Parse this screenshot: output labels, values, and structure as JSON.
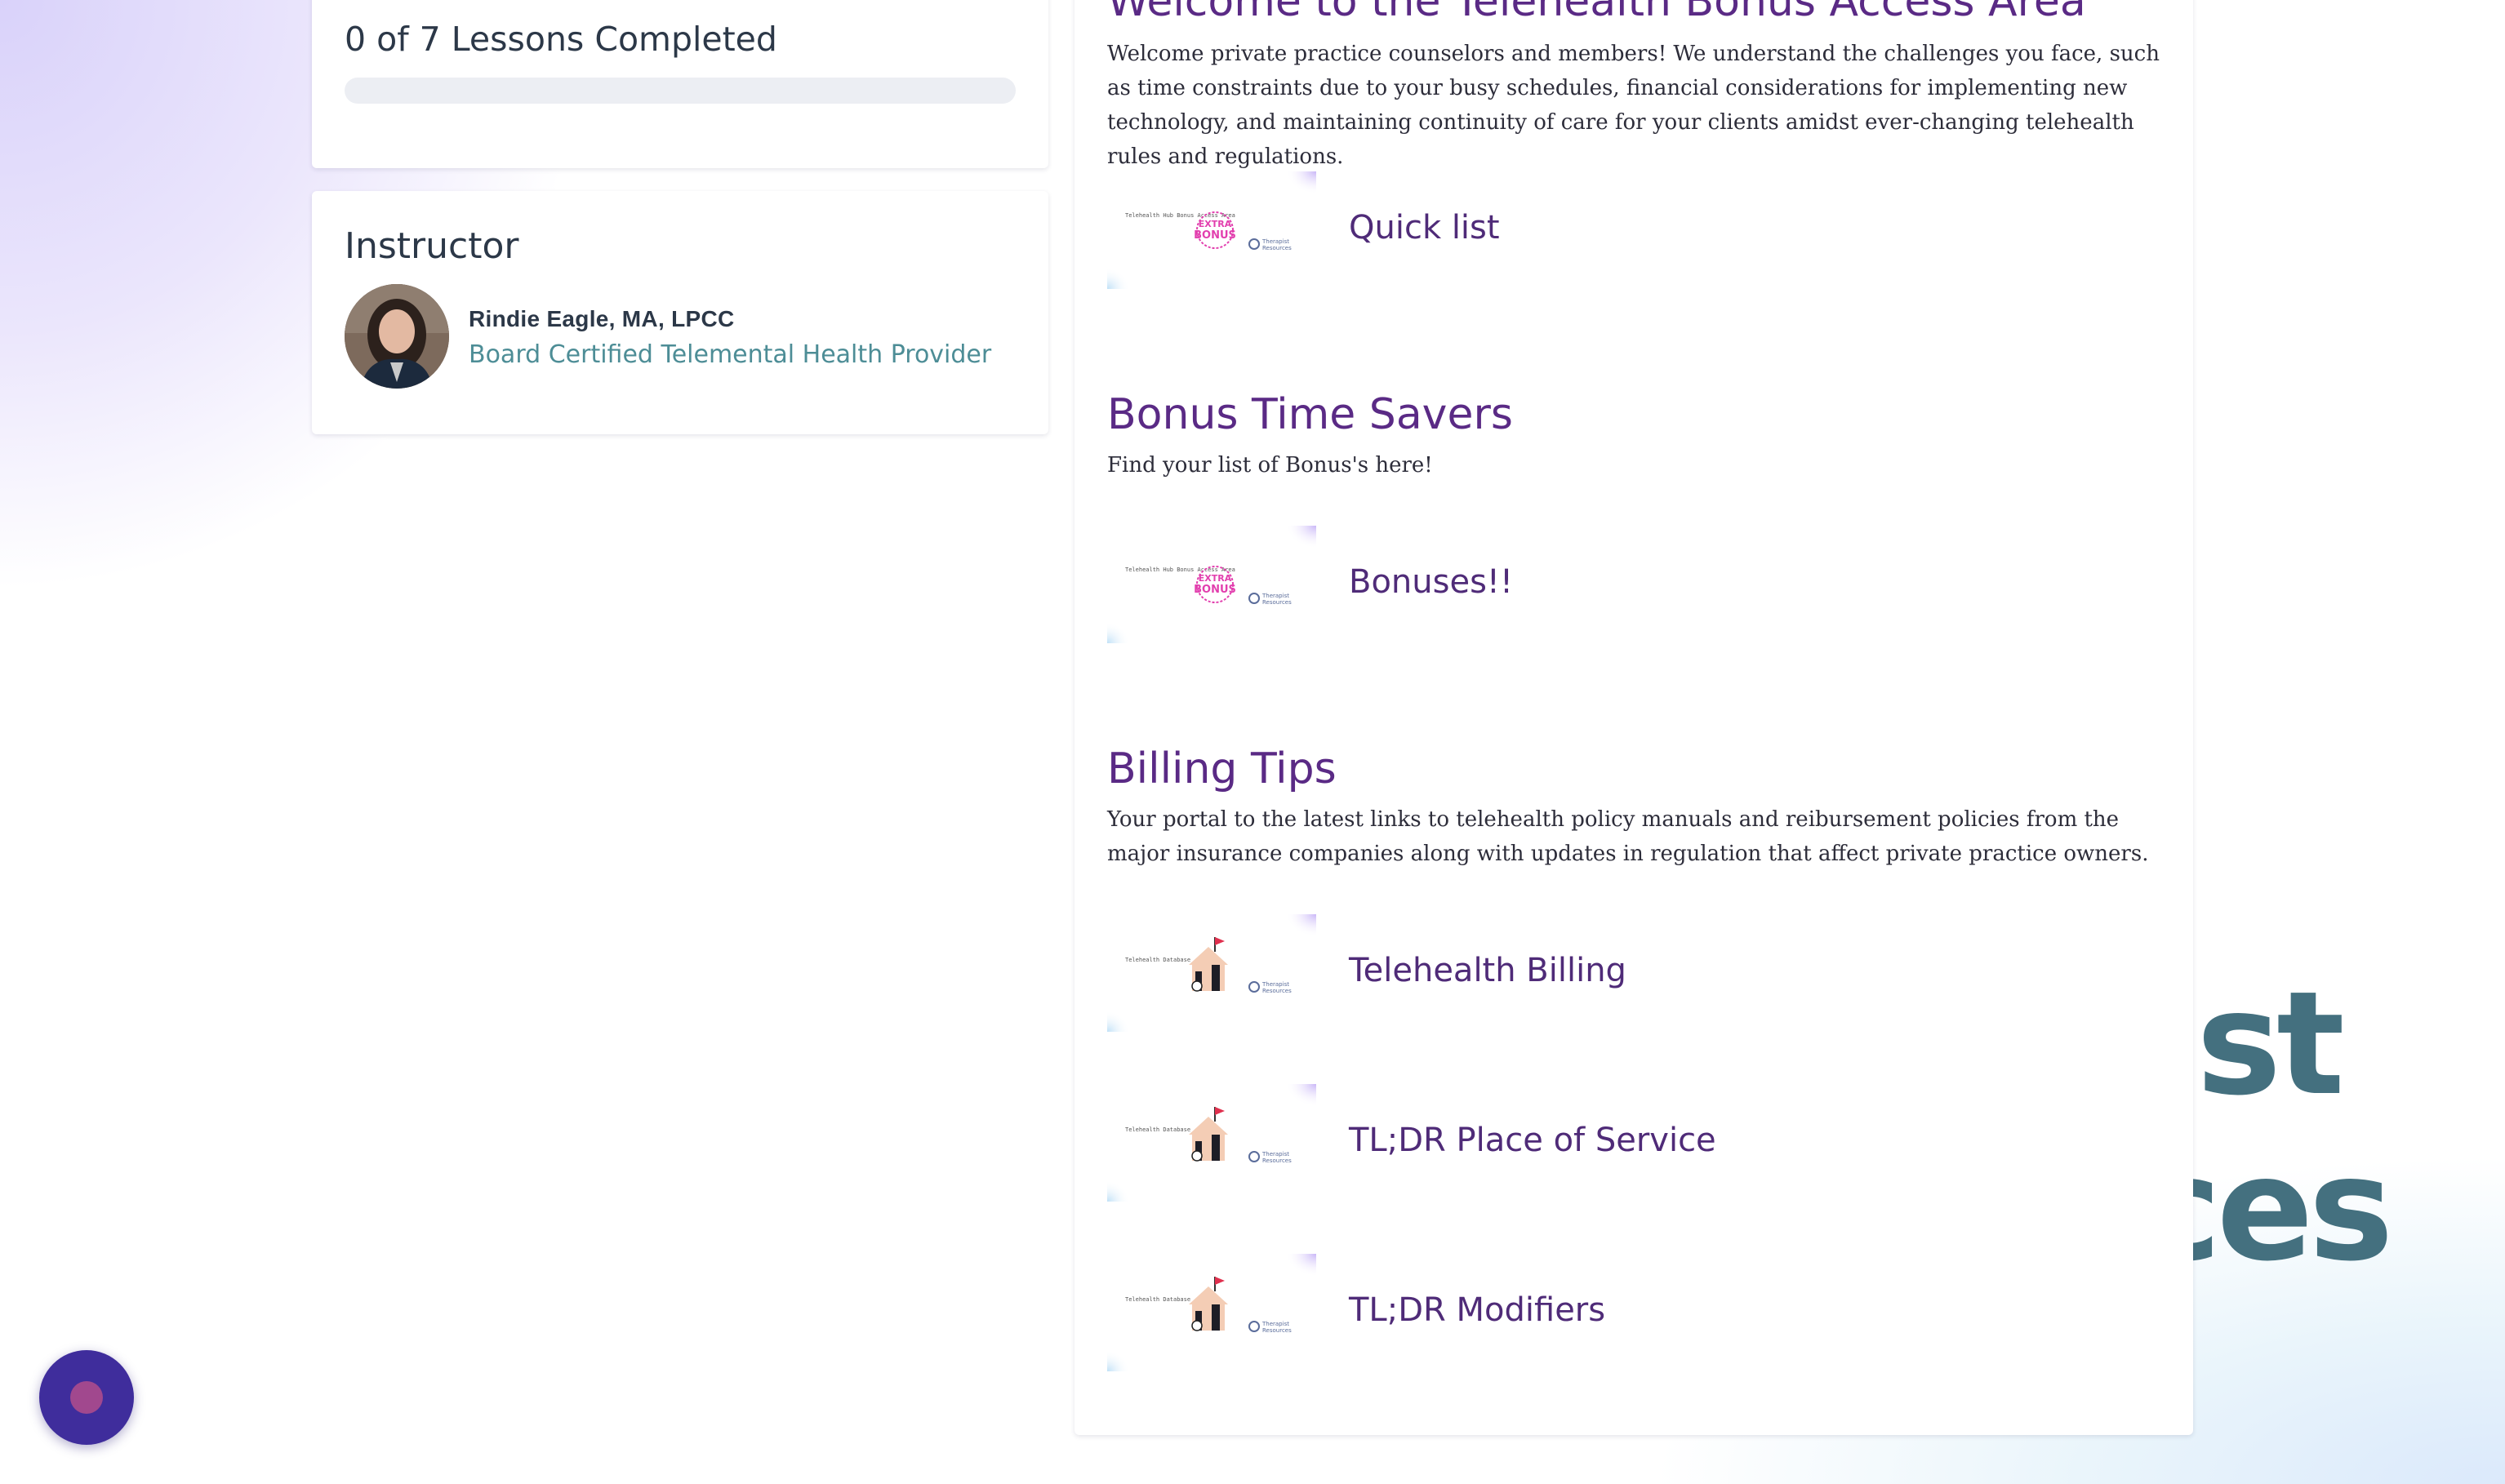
{
  "background": {
    "word_line_1": "ist",
    "word_line_2": "ces"
  },
  "progress": {
    "title": "0 of 7 Lessons Completed",
    "completed": 0,
    "total": 7,
    "fraction": 0
  },
  "instructor": {
    "heading": "Instructor",
    "name": "Rindie Eagle, MA, LPCC",
    "role": "Board Certified Telemental Health Provider"
  },
  "sections": [
    {
      "title": "Welcome to the Telehealth Bonus Access Area",
      "description": "Welcome private practice counselors and members! We understand the challenges you face, such as time constraints due to your busy schedules, financial considerations for implementing new technology, and maintaining continuity of care for your clients amidst ever-changing telehealth rules and regulations.",
      "lessons": [
        {
          "label": "Quick list",
          "thumb": "bonus",
          "thumb_caption": "Telehealth Hub Bonus Access Area",
          "badge": "EXTRA BONUS",
          "brand": "Therapist Resources"
        }
      ]
    },
    {
      "title": "Bonus Time Savers",
      "description": "Find your list of Bonus's here!",
      "lessons": [
        {
          "label": "Bonuses!!",
          "thumb": "bonus",
          "thumb_caption": "Telehealth Hub Bonus Access Area",
          "badge": "EXTRA BONUS",
          "brand": "Therapist Resources"
        }
      ]
    },
    {
      "title": "Billing Tips",
      "description": "Your portal to the latest links to telehealth policy manuals and reibursement policies from the major insurance companies along with updates in regulation that affect private practice owners.",
      "lessons": [
        {
          "label": "Telehealth Billing",
          "thumb": "database",
          "thumb_caption": "Telehealth Database",
          "brand": "Therapist Resources"
        },
        {
          "label": "TL;DR Place of Service",
          "thumb": "database",
          "thumb_caption": "Telehealth Database",
          "brand": "Therapist Resources"
        },
        {
          "label": "TL;DR Modifiers",
          "thumb": "database",
          "thumb_caption": "Telehealth Database",
          "brand": "Therapist Resources"
        }
      ]
    }
  ],
  "colors": {
    "accent_purple": "#5a2a85",
    "teal_link": "#4d8d96",
    "chat_button": "#3f2d9c",
    "badge_pink": "#e23fae"
  }
}
